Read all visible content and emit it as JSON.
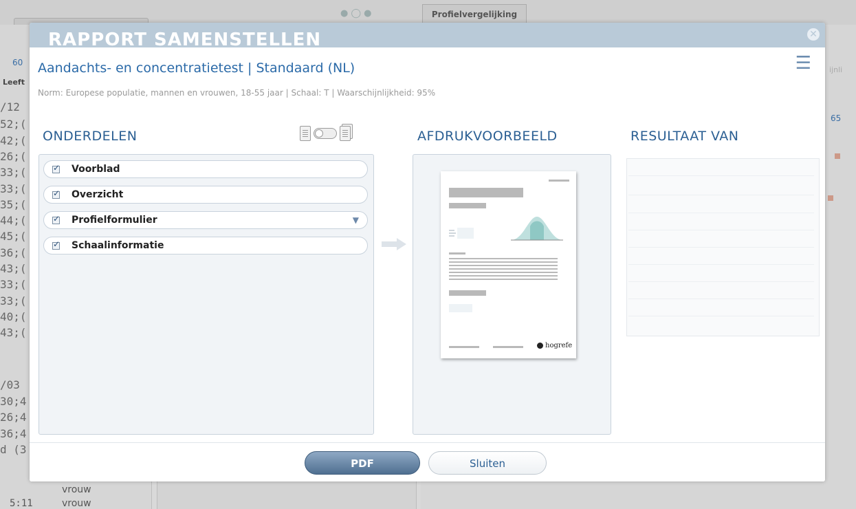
{
  "background": {
    "tab_label": "Profielvergelijking",
    "left_number": "60",
    "right_number": "65",
    "left_header": "Leeft",
    "right_header_fragment": "ijnli",
    "rows": [
      "/12",
      "52;(",
      "42;(",
      "26;(",
      "33;(",
      "33;(",
      "35;(",
      "44;(",
      "45;(",
      "36;(",
      "43;(",
      "33;(",
      "33;(",
      "40;(",
      "43;(",
      "/03",
      "30;4",
      "26;4",
      "36;4",
      "d (3"
    ],
    "gender_rows": [
      "vrouw",
      "vrouw"
    ],
    "time_fragment": "5:11"
  },
  "modal": {
    "title": "RAPPORT SAMENSTELLEN",
    "close_icon": "close-icon",
    "test_title": "Aandachts- en concentratietest | Standaard (NL)",
    "menu_icon": "hamburger-menu-icon",
    "norm_line": "Norm: Europese populatie, mannen en vrouwen, 18-55 jaar | Schaal: T | Waarschijnlijkheid: 95%",
    "sections": {
      "onderdelen": "ONDERDELEN",
      "afdruk": "AFDRUKVOORBEELD",
      "resultaat": "RESULTAAT VAN"
    },
    "parts": [
      {
        "label": "Voorblad",
        "checked": true,
        "has_dropdown": false
      },
      {
        "label": "Overzicht",
        "checked": true,
        "has_dropdown": false
      },
      {
        "label": "Profielformulier",
        "checked": true,
        "has_dropdown": true
      },
      {
        "label": "Schaalinformatie",
        "checked": true,
        "has_dropdown": false
      }
    ],
    "preview_brand": "hogrefe",
    "buttons": {
      "pdf": "PDF",
      "close": "Sluiten"
    },
    "colors": {
      "header": "#b9cad8",
      "accent": "#2b5f93",
      "pdf_button": "#4f6f91"
    }
  }
}
